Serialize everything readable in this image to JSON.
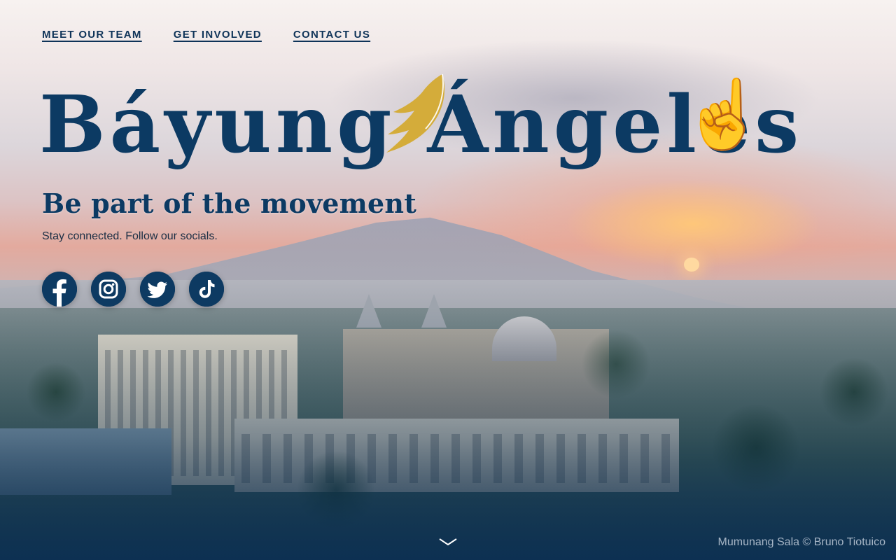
{
  "nav": {
    "items": [
      {
        "label": "MEET OUR TEAM"
      },
      {
        "label": "GET INVOLVED"
      },
      {
        "label": "CONTACT US"
      }
    ]
  },
  "hero": {
    "title": "Báyung Ángeles",
    "emoji": "☝️",
    "subtitle": "Be part of the movement",
    "tagline": "Stay connected. Follow our socials."
  },
  "socials": [
    {
      "name": "facebook-icon"
    },
    {
      "name": "instagram-icon"
    },
    {
      "name": "twitter-icon"
    },
    {
      "name": "tiktok-icon"
    }
  ],
  "footer": {
    "scroll_icon": "chevron-down-icon",
    "photo_credit": "Mumunang Sala © Bruno Tiotuico"
  },
  "colors": {
    "brand_navy": "#0c3a63",
    "wing_gold": "#d4ac3a",
    "footer_navy": "#0b2f52"
  }
}
